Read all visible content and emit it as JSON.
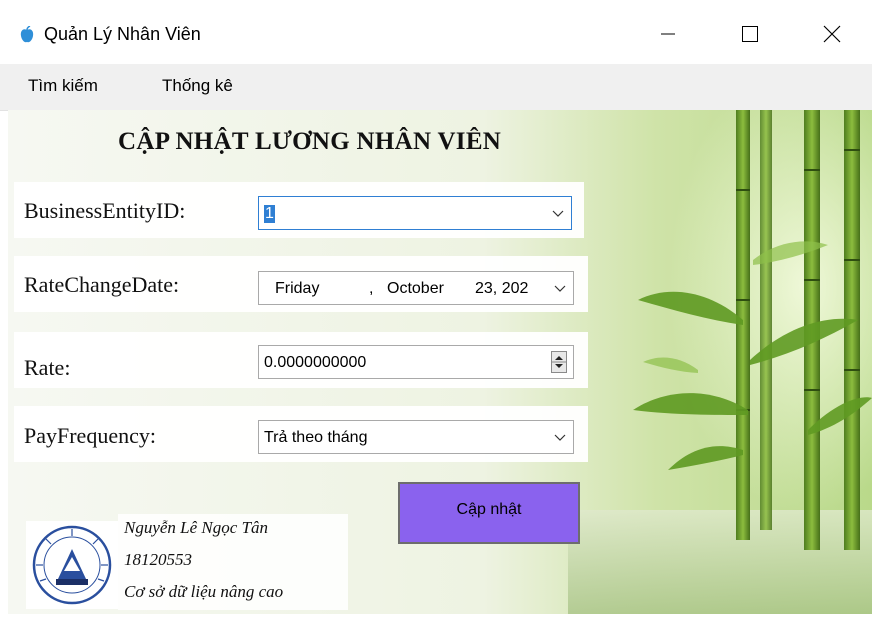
{
  "window": {
    "title": "Quản Lý Nhân Viên",
    "minimize_icon": "minimize-icon",
    "maximize_icon": "maximize-icon",
    "close_icon": "close-icon"
  },
  "menu": [
    {
      "label": "Tìm kiếm"
    },
    {
      "label": "Thống kê"
    }
  ],
  "form": {
    "heading": "CẬP NHẬT LƯƠNG NHÂN VIÊN",
    "business_entity_id": {
      "label": "BusinessEntityID:",
      "value": "1"
    },
    "rate_change_date": {
      "label": "RateChangeDate:",
      "weekday": "Friday",
      "sep": ",",
      "month": "October",
      "day_year": "23, 202"
    },
    "rate": {
      "label": "Rate:",
      "value": "0.0000000000"
    },
    "pay_frequency": {
      "label": "PayFrequency:",
      "value": "Trả theo tháng"
    },
    "update_button": "Cập nhật"
  },
  "signature": {
    "name": "Nguyễn Lê Ngọc Tân",
    "student_id": "18120553",
    "course": "Cơ sở dữ liệu nâng cao"
  },
  "colors": {
    "button": "#8a62ee",
    "focus_border": "#2f7fd3"
  }
}
